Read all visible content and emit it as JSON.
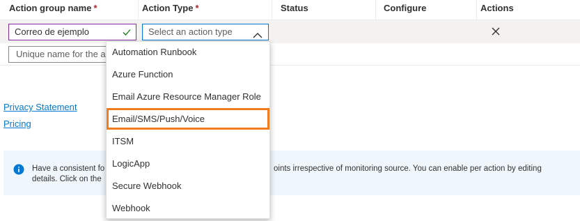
{
  "table": {
    "headers": {
      "name": "Action group name",
      "type": "Action Type",
      "status": "Status",
      "configure": "Configure",
      "actions": "Actions"
    },
    "required_mark": "*",
    "row": {
      "name_value": "Correo de ejemplo",
      "type_placeholder": "Select an action type"
    },
    "new_row": {
      "name_placeholder": "Unique name for the ac"
    }
  },
  "dropdown": {
    "options": [
      "Automation Runbook",
      "Azure Function",
      "Email Azure Resource Manager Role",
      "Email/SMS/Push/Voice",
      "ITSM",
      "LogicApp",
      "Secure Webhook",
      "Webhook"
    ],
    "highlighted": "Email/SMS/Push/Voice"
  },
  "links": {
    "privacy": "Privacy Statement",
    "pricing": "Pricing"
  },
  "banner": {
    "line1_left": "Have a consistent fo",
    "line1_right": "oints irrespective of monitoring source. You can enable per action by editing",
    "line2_left": "details. Click on the"
  },
  "colors": {
    "accent": "#0078d4",
    "highlight_border": "#f07c1e",
    "required": "#a4262c",
    "field_focus": "#8a2da5"
  },
  "icons": [
    "check-icon",
    "chevron-up-icon",
    "close-icon",
    "info-icon"
  ]
}
